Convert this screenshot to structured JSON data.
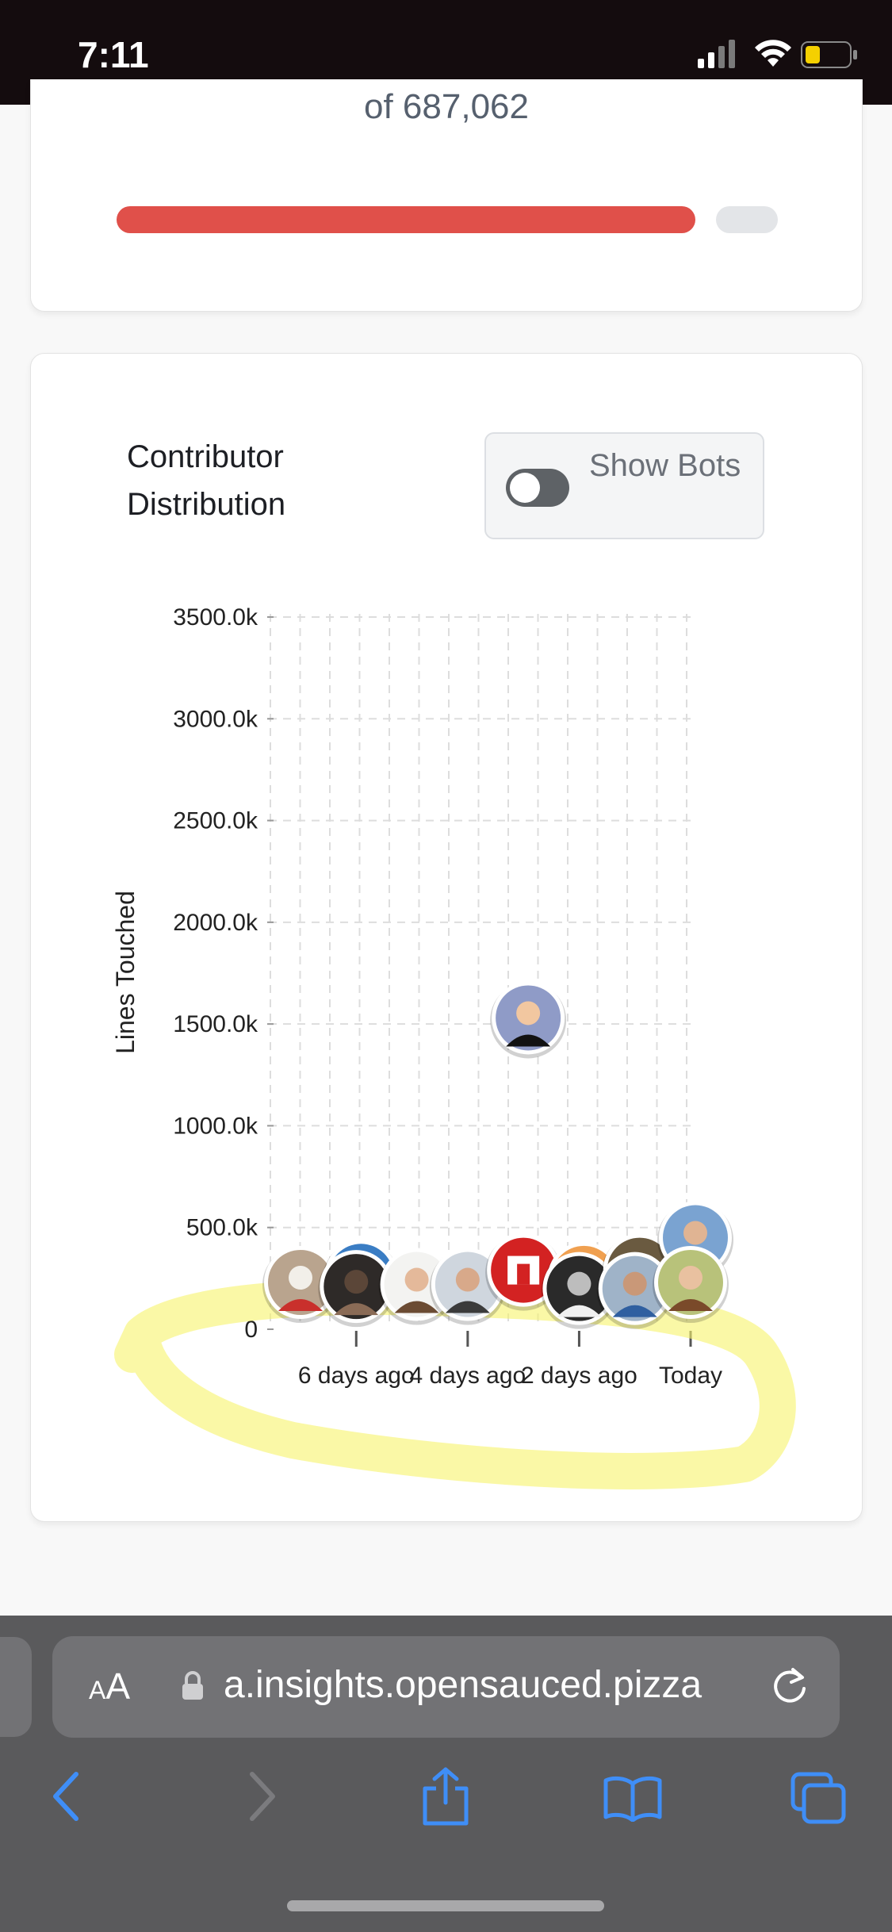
{
  "status_bar": {
    "time": "7:11",
    "icons": [
      "cellular-signal-icon",
      "wifi-icon",
      "battery-low-icon"
    ]
  },
  "summary_card": {
    "of_total": "of 687,062",
    "progress_fraction": 0.89
  },
  "distribution_card": {
    "title": "Contributor Distribution",
    "show_bots_label": "Show Bots",
    "show_bots_enabled": false
  },
  "chart_data": {
    "type": "scatter",
    "ylabel": "Lines Touched",
    "y_ticks": [
      "0",
      "500.0k",
      "1000.0k",
      "1500.0k",
      "2000.0k",
      "2500.0k",
      "3000.0k",
      "3500.0k"
    ],
    "x_ticks": [
      "6 days ago",
      "4 days ago",
      "2 days ago",
      "Today"
    ],
    "ylim": [
      0,
      3500
    ],
    "y_units": "thousand lines",
    "xlim_days_ago": [
      7,
      0
    ],
    "grid": true,
    "point_style": "contributor-avatar",
    "points": [
      {
        "days_ago": 7.0,
        "lines_k": 230,
        "avatar": "avatar-cat-photo"
      },
      {
        "days_ago": 6.0,
        "lines_k": 260,
        "avatar": "avatar-blue-sky"
      },
      {
        "days_ago": 6.0,
        "lines_k": 210,
        "avatar": "avatar-man-dark"
      },
      {
        "days_ago": 5.0,
        "lines_k": 220,
        "avatar": "avatar-young-man"
      },
      {
        "days_ago": 4.0,
        "lines_k": 220,
        "avatar": "avatar-man-smiling"
      },
      {
        "days_ago": 3.0,
        "lines_k": 1530,
        "avatar": "avatar-cartoon-glasses"
      },
      {
        "days_ago": 3.0,
        "lines_k": 290,
        "avatar": "avatar-red-logo"
      },
      {
        "days_ago": 2.0,
        "lines_k": 250,
        "avatar": "avatar-orange-ring"
      },
      {
        "days_ago": 2.0,
        "lines_k": 200,
        "avatar": "avatar-bw-portrait"
      },
      {
        "days_ago": 1.0,
        "lines_k": 290,
        "avatar": "avatar-man-glasses"
      },
      {
        "days_ago": 1.0,
        "lines_k": 200,
        "avatar": "avatar-man-blue-shirt"
      },
      {
        "days_ago": 0.0,
        "lines_k": 450,
        "avatar": "avatar-man-cap"
      },
      {
        "days_ago": 0.0,
        "lines_k": 230,
        "avatar": "avatar-woman-smiling"
      }
    ],
    "annotation": "yellow-freehand-highlight"
  },
  "browser": {
    "aa_label_large": "A",
    "aa_label_small": "A",
    "url": "a.insights.opensauced.pizza",
    "toolbar_icons": [
      "back-icon",
      "forward-icon",
      "share-icon",
      "bookmarks-icon",
      "tabs-icon"
    ]
  }
}
